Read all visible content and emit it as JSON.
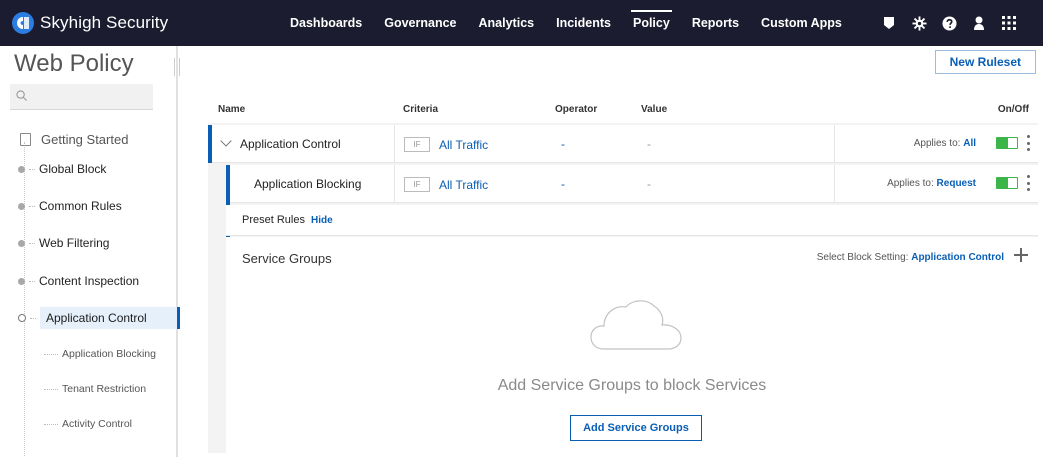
{
  "brand": {
    "name": "Skyhigh Security"
  },
  "nav": {
    "items": [
      {
        "label": "Dashboards"
      },
      {
        "label": "Governance"
      },
      {
        "label": "Analytics"
      },
      {
        "label": "Incidents"
      },
      {
        "label": "Policy",
        "active": true
      },
      {
        "label": "Reports"
      },
      {
        "label": "Custom Apps"
      }
    ],
    "icons": [
      "shield-icon",
      "gear-icon",
      "help-icon",
      "user-icon",
      "apps-grid-icon"
    ]
  },
  "sidebar": {
    "title": "Web Policy",
    "search": {
      "placeholder": "",
      "value": ""
    },
    "getting_started": "Getting Started",
    "items": [
      {
        "label": "Global Block"
      },
      {
        "label": "Common Rules"
      },
      {
        "label": "Web Filtering"
      },
      {
        "label": "Content Inspection"
      },
      {
        "label": "Application Control",
        "active": true
      }
    ],
    "subitems": [
      {
        "label": "Application Blocking"
      },
      {
        "label": "Tenant Restriction"
      },
      {
        "label": "Activity Control"
      }
    ]
  },
  "main": {
    "new_ruleset_label": "New Ruleset",
    "columns": {
      "name": "Name",
      "criteria": "Criteria",
      "operator": "Operator",
      "value": "Value",
      "onoff": "On/Off"
    },
    "rows": [
      {
        "name": "Application Control",
        "if_label": "IF",
        "criteria": "All Traffic",
        "operator": "-",
        "value": "-",
        "applies_label": "Applies to:",
        "applies_value": "All",
        "enabled": true
      },
      {
        "name": "Application Blocking",
        "if_label": "IF",
        "criteria": "All Traffic",
        "operator": "-",
        "value": "-",
        "applies_label": "Applies to:",
        "applies_value": "Request",
        "enabled": true
      }
    ],
    "preset": {
      "label": "Preset Rules",
      "toggle_label": "Hide"
    },
    "services": {
      "title": "Service Groups",
      "select_label": "Select Block Setting:",
      "select_value": "Application Control",
      "empty_text": "Add Service Groups to block Services",
      "add_button": "Add Service Groups"
    }
  },
  "colors": {
    "topbar": "#1b1c2f",
    "accent": "#0a5fb5",
    "toggle_on": "#3bb54a"
  }
}
